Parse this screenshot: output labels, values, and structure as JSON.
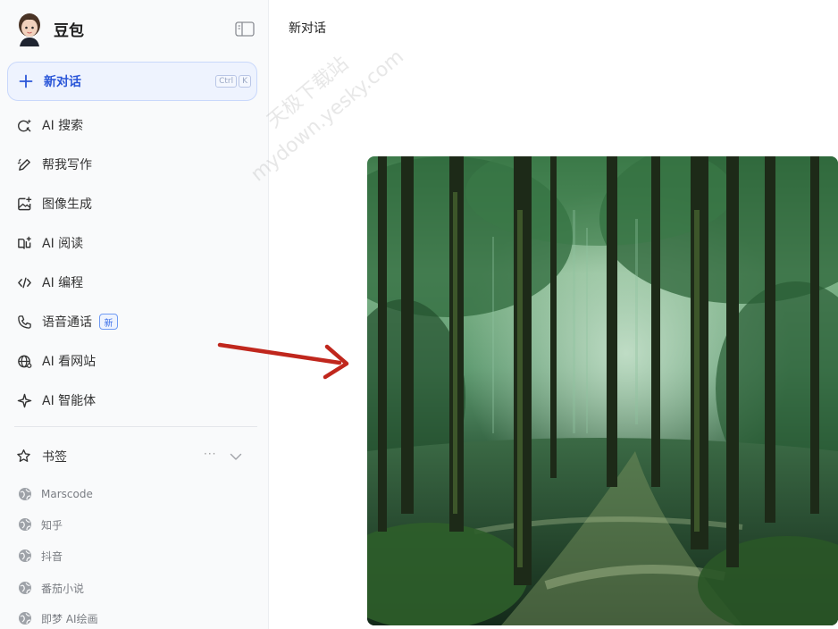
{
  "app": {
    "name": "豆包"
  },
  "new_chat": {
    "label": "新对话",
    "shortcut": [
      "Ctrl",
      "K"
    ]
  },
  "nav": [
    {
      "label": "AI 搜索",
      "icon": "search-spark-icon"
    },
    {
      "label": "帮我写作",
      "icon": "pen-icon"
    },
    {
      "label": "图像生成",
      "icon": "image-plus-icon"
    },
    {
      "label": "AI 阅读",
      "icon": "book-icon"
    },
    {
      "label": "AI 编程",
      "icon": "code-icon"
    },
    {
      "label": "语音通话",
      "icon": "phone-icon",
      "badge": "新"
    },
    {
      "label": "AI 看网站",
      "icon": "globe-icon"
    },
    {
      "label": "AI 智能体",
      "icon": "sparkle-icon"
    }
  ],
  "bookmarks": {
    "title": "书签",
    "more": "···",
    "items": [
      "Marscode",
      "知乎",
      "抖音",
      "番茄小说",
      "即梦 AI绘画"
    ]
  },
  "main": {
    "title": "新对话"
  },
  "watermark": {
    "line1": "天极下载站",
    "line2": "mydown.yesky.com"
  },
  "colors": {
    "accent": "#2a56d8",
    "sidebar_bg": "#f9fafb",
    "arrow": "#c0271d"
  }
}
